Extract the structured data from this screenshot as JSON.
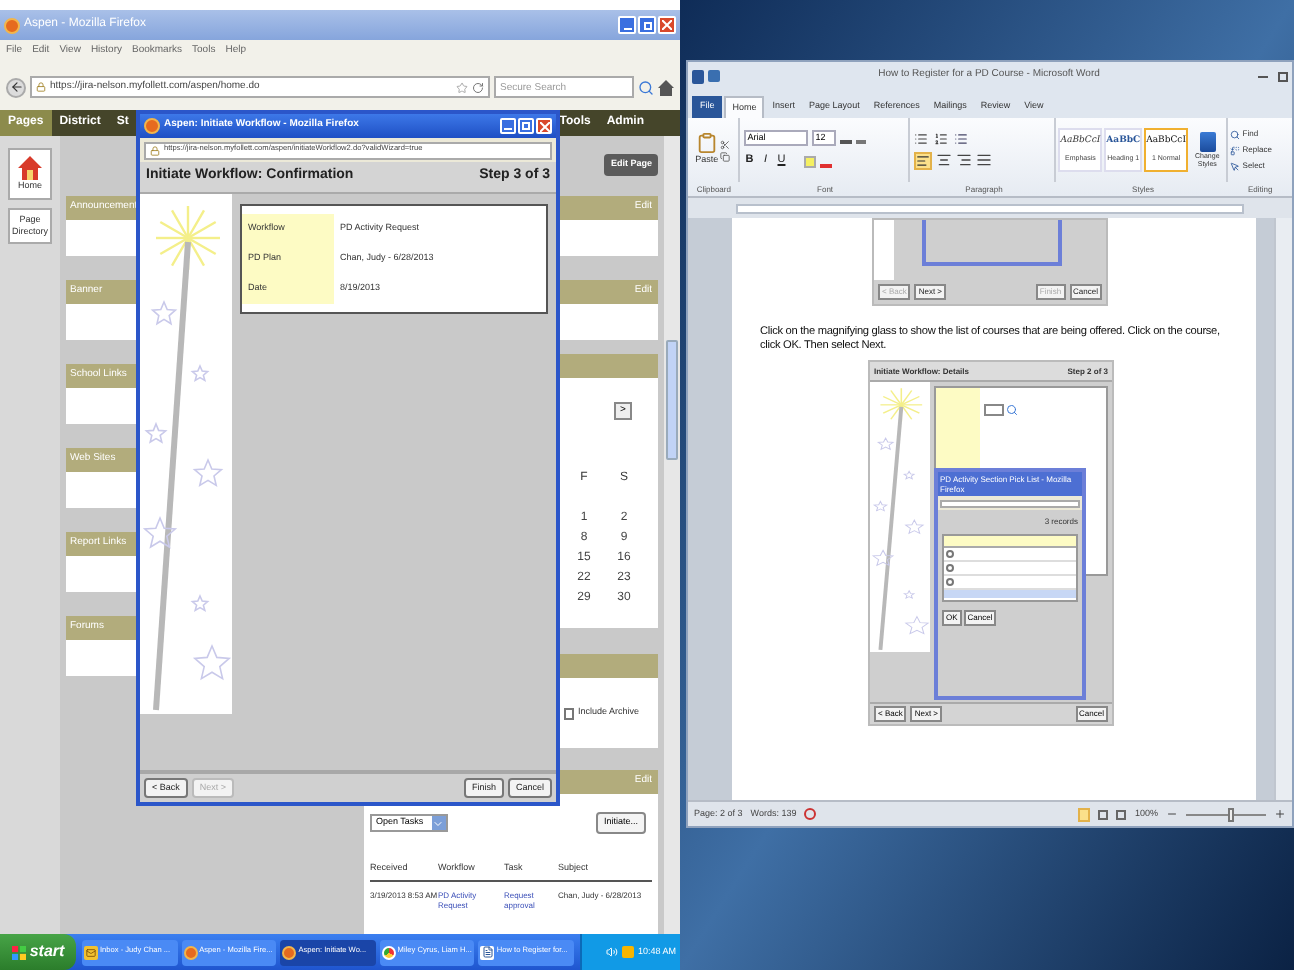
{
  "firefox": {
    "title": "Aspen - Mozilla Firefox",
    "menu": [
      "File",
      "Edit",
      "View",
      "History",
      "Bookmarks",
      "Tools",
      "Help"
    ],
    "url": "https://jira-nelson.myfollett.com/aspen/home.do",
    "search": {
      "placeholder": "Secure Search"
    }
  },
  "aspen": {
    "nav_left": [
      {
        "label": "Pages",
        "selected": true
      },
      {
        "label": "District",
        "selected": false
      },
      {
        "label": "St",
        "selected": false
      }
    ],
    "nav_right": [
      {
        "label": "Tools",
        "selected": false
      },
      {
        "label": "Admin",
        "selected": false
      }
    ],
    "sidebar": [
      {
        "label": "Home",
        "kind": "home"
      },
      {
        "label": "Page Directory",
        "kind": "text"
      }
    ],
    "edit_page": "Edit Page",
    "left_widgets": [
      {
        "title": "Announcement"
      },
      {
        "title": "Banner"
      },
      {
        "title": "School Links"
      },
      {
        "title": "Web Sites"
      },
      {
        "title": "Report Links"
      },
      {
        "title": "Forums"
      }
    ],
    "right_widgets": [
      {
        "kind": "plain",
        "action": "Edit"
      },
      {
        "kind": "plain",
        "action": "Edit"
      },
      {
        "kind": "calendar"
      },
      {
        "kind": "archive"
      },
      {
        "kind": "workflow",
        "action": "Edit"
      }
    ],
    "calendar": {
      "next": ">",
      "columns": [
        {
          "day": "F",
          "dates": [
            "1",
            "8",
            "15",
            "22",
            "29"
          ]
        },
        {
          "day": "S",
          "dates": [
            "2",
            "9",
            "16",
            "23",
            "30"
          ]
        }
      ]
    },
    "archive": {
      "label": "Include Archive",
      "checked": false
    },
    "workflow": {
      "filter": "Open Tasks",
      "initiate": "Initiate...",
      "columns": [
        "Received",
        "Workflow",
        "Task",
        "Subject"
      ],
      "rows": [
        [
          "3/19/2013 8:53 AM",
          "PD Activity Request",
          "Request approval",
          "Chan, Judy - 6/28/2013"
        ]
      ]
    }
  },
  "dialog": {
    "title": "Aspen: Initiate Workflow - Mozilla Firefox",
    "url": "https://jira-nelson.myfollett.com/aspen/initiateWorkflow2.do?validWizard=true",
    "heading": "Initiate Workflow: Confirmation",
    "step": "Step 3 of 3",
    "fields": [
      {
        "label": "Workflow",
        "value": "PD Activity Request"
      },
      {
        "label": "PD Plan",
        "value": "Chan, Judy - 6/28/2013"
      },
      {
        "label": "Date",
        "value": "8/19/2013"
      }
    ],
    "buttons": [
      {
        "label": "< Back",
        "disabled": false
      },
      {
        "label": "Next >",
        "disabled": true
      },
      {
        "label": "Finish",
        "disabled": false
      },
      {
        "label": "Cancel",
        "disabled": false
      }
    ]
  },
  "taskbar": {
    "start": "start",
    "items": [
      {
        "label": "Inbox - Judy Chan ...",
        "kind": "mail",
        "selected": false
      },
      {
        "label": "Aspen - Mozilla Fire...",
        "kind": "browser",
        "selected": false
      },
      {
        "label": "Aspen: Initiate Wo...",
        "kind": "browser",
        "selected": true
      },
      {
        "label": "Miley Cyrus, Liam H...",
        "kind": "chrome",
        "selected": false
      },
      {
        "label": "How to Register for...",
        "kind": "document",
        "selected": false
      }
    ],
    "clock": "10:48 AM"
  },
  "word": {
    "title": "How to Register for a PD Course - Microsoft Word",
    "tabs": [
      {
        "label": "File",
        "kind": "file",
        "selected": false
      },
      {
        "label": "Home",
        "kind": "tab",
        "selected": true
      },
      {
        "label": "Insert",
        "kind": "tab",
        "selected": false
      },
      {
        "label": "Page Layout",
        "kind": "tab",
        "selected": false
      },
      {
        "label": "References",
        "kind": "tab",
        "selected": false
      },
      {
        "label": "Mailings",
        "kind": "tab",
        "selected": false
      },
      {
        "label": "Review",
        "kind": "tab",
        "selected": false
      },
      {
        "label": "View",
        "kind": "tab",
        "selected": false
      }
    ],
    "paste": "Paste",
    "font": "Arial",
    "size": "12",
    "format_buttons": [
      "B",
      "I",
      "U"
    ],
    "styles": [
      {
        "sample": "AaBbCcI",
        "name": "Emphasis",
        "kind": "emphasis",
        "selected": false
      },
      {
        "sample": "AaBbC",
        "name": "Heading 1",
        "kind": "heading",
        "selected": false
      },
      {
        "sample": "AaBbCcI",
        "name": "1 Normal",
        "kind": "normal",
        "selected": true
      }
    ],
    "change_styles": "Change Styles",
    "editing": [
      "Find",
      "Replace",
      "Select"
    ],
    "groups": [
      "Clipboard",
      "Font",
      "Paragraph",
      "Styles",
      "Editing"
    ],
    "fragment_buttons": [
      "< Back",
      "Next >",
      "Finish",
      "Cancel"
    ],
    "paragraph": "Click on the magnifying glass to show the list of courses that are being offered.  Click on the course, click OK. Then select Next.",
    "embedded": {
      "heading": "Initiate Workflow: Details",
      "step": "Step 2 of 3",
      "popup_title": "PD Activity Section Pick List - Mozilla Firefox",
      "records": "3 records",
      "popup_buttons": [
        "OK",
        "Cancel"
      ],
      "radios": [
        {
          "selected": false
        },
        {
          "selected": false
        },
        {
          "selected": false
        }
      ],
      "buttons": [
        "< Back",
        "Next >"
      ],
      "right_button": "Cancel"
    },
    "status": {
      "page": "Page: 2 of 3",
      "words": "Words: 139",
      "zoom": {
        "label": "100%",
        "level": 0.55
      }
    }
  }
}
